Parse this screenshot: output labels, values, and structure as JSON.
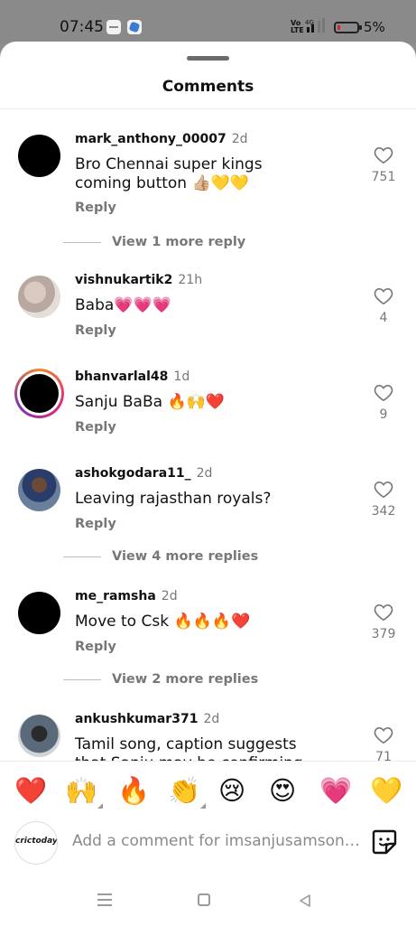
{
  "status_bar": {
    "time": "07:45",
    "network": "Vo LTE",
    "signal_label": "4G",
    "battery": "5%"
  },
  "sheet": {
    "title": "Comments"
  },
  "comments": [
    {
      "user": "mark_anthony_00007",
      "time": "2d",
      "text": "Bro Chennai super kings coming button 👍🏼💛💛",
      "likes": "751",
      "reply": "Reply",
      "more": "View 1 more reply"
    },
    {
      "user": "vishnukartik2",
      "time": "21h",
      "text": "Baba💗💗💗",
      "likes": "4",
      "reply": "Reply",
      "more": ""
    },
    {
      "user": "bhanvarlal48",
      "time": "1d",
      "text": "Sanju BaBa 🔥🙌❤️",
      "likes": "9",
      "reply": "Reply",
      "more": ""
    },
    {
      "user": "ashokgodara11_",
      "time": "2d",
      "text": "Leaving rajasthan royals?",
      "likes": "342",
      "reply": "Reply",
      "more": "View 4 more replies"
    },
    {
      "user": "me_ramsha",
      "time": "2d",
      "text": "Move to Csk 🔥🔥🔥❤️",
      "likes": "379",
      "reply": "Reply",
      "more": "View 2 more replies"
    },
    {
      "user": "ankushkumar371",
      "time": "2d",
      "text": "Tamil song, caption suggests that Sanju may be confirming his move to",
      "likes": "71",
      "reply": "",
      "more": ""
    }
  ],
  "reactions": [
    "❤️",
    "🙌",
    "🔥",
    "👏",
    "😢",
    "😍",
    "💗",
    "💛"
  ],
  "composer": {
    "avatar_text": "crictoday",
    "placeholder": "Add a comment for imsanjusamson…"
  },
  "icons": {
    "like": "heart-outline-icon",
    "sticker": "sticker-icon",
    "nav": [
      "menu-icon",
      "home-icon",
      "back-icon"
    ]
  },
  "colors": {
    "sheet_bg": "#ffffff",
    "dimmed_bg": "#8e8e8e",
    "secondary_text": "#777777"
  }
}
